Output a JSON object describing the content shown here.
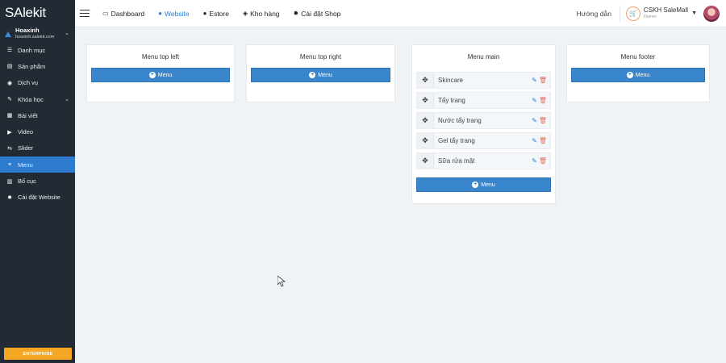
{
  "sidebar": {
    "logo": "SAlekit",
    "shop_name": "Hoaxinh",
    "shop_domain": "hoaxinh.salekit.com",
    "items": [
      {
        "label": "Danh mục",
        "icon": "list-icon"
      },
      {
        "label": "Sản phẩm",
        "icon": "product-icon"
      },
      {
        "label": "Dịch vụ",
        "icon": "service-icon"
      },
      {
        "label": "Khóa học",
        "icon": "course-icon"
      },
      {
        "label": "Bài viết",
        "icon": "article-icon"
      },
      {
        "label": "Video",
        "icon": "video-icon"
      },
      {
        "label": "Slider",
        "icon": "slider-icon"
      },
      {
        "label": "Menu",
        "icon": "menu-icon"
      },
      {
        "label": "Bố cục",
        "icon": "layout-icon"
      },
      {
        "label": "Cài đặt Website",
        "icon": "gear-icon"
      }
    ],
    "active": "Menu",
    "plan_label": "ENTERPRISE"
  },
  "topbar": {
    "nav": [
      {
        "label": "Dashboard",
        "icon": "monitor-icon"
      },
      {
        "label": "Website",
        "icon": "globe-icon"
      },
      {
        "label": "Estore",
        "icon": "globe-icon"
      },
      {
        "label": "Kho hàng",
        "icon": "stack-icon"
      },
      {
        "label": "Cài đặt Shop",
        "icon": "gear-icon"
      }
    ],
    "active": "Website",
    "help": "Hướng dẫn",
    "user_name": "CSKH SaleMall",
    "user_role": "Owner"
  },
  "cards": {
    "top_left": {
      "title": "Menu top left",
      "button": "Menu"
    },
    "top_right": {
      "title": "Menu top right",
      "button": "Menu"
    },
    "main": {
      "title": "Menu main",
      "button": "Menu",
      "items": [
        "Skincare",
        "Tẩy trang",
        "Nước tẩy trang",
        "Gel tẩy trang",
        "Sữa rửa mặt"
      ]
    },
    "footer": {
      "title": "Menu footer",
      "button": "Menu"
    }
  },
  "colors": {
    "sidebar_bg": "#222a33",
    "accent": "#2e7ccf",
    "button": "#3a86cc",
    "plan": "#f5a623",
    "delete": "#e0705f"
  }
}
